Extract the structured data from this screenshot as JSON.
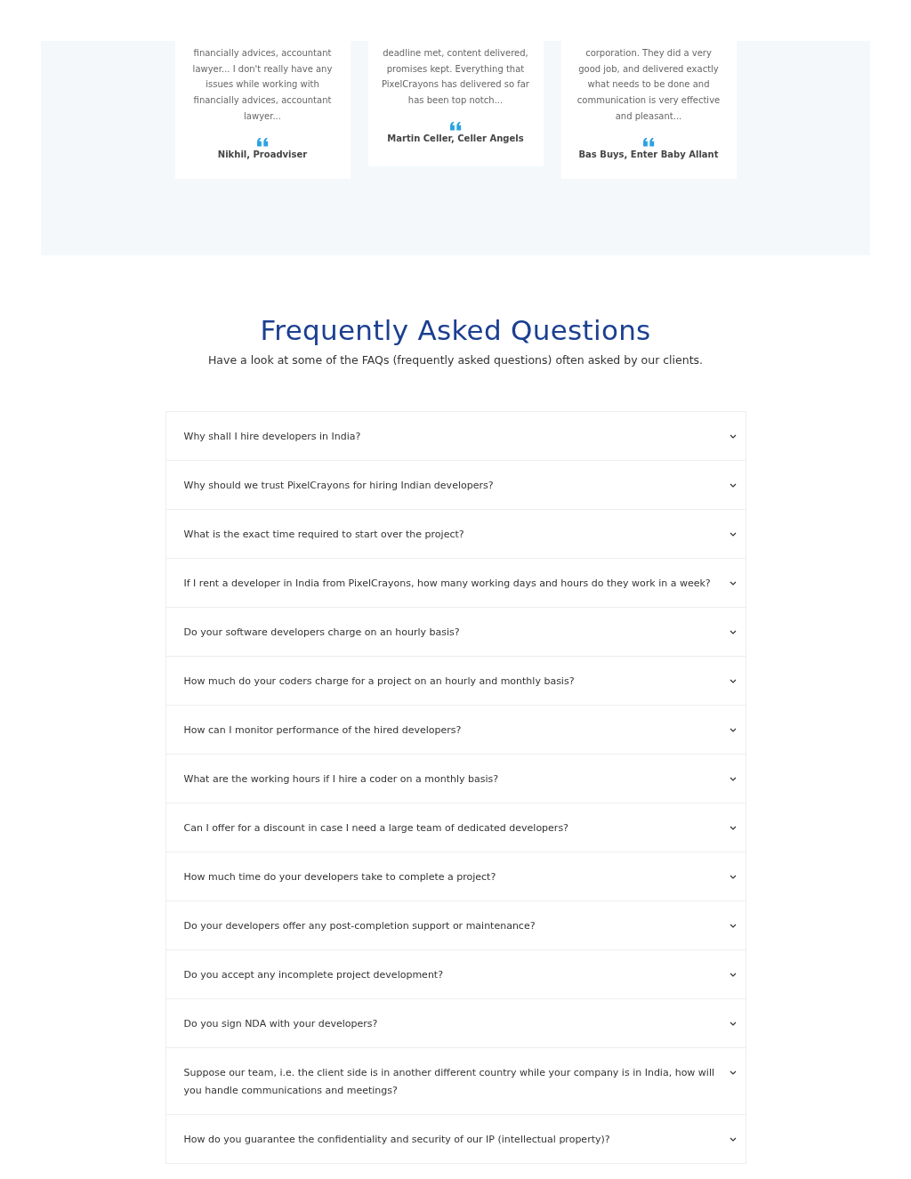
{
  "testimonials": [
    {
      "quote": "financially advices, accountant lawyer... I don't really have any issues while working with financially advices, accountant lawyer...",
      "author": "Nikhil, Proadviser"
    },
    {
      "quote": "deadline met, content delivered, promises kept. Everything that PixelCrayons has delivered so far has been top notch...",
      "author": "Martin Celler, Celler Angels"
    },
    {
      "quote": "corporation. They did a very good job, and delivered exactly what needs to be done and communication is very effective and pleasant...",
      "author": "Bas Buys, Enter Baby Allant"
    }
  ],
  "faq": {
    "title": "Frequently Asked Questions",
    "subtitle": "Have a look at some of the FAQs (frequently asked questions) often asked by our clients.",
    "items": [
      {
        "question": "Why shall I hire developers in India?",
        "expanded": false
      },
      {
        "question": "Why should we trust PixelCrayons for hiring Indian developers?",
        "expanded": false
      },
      {
        "question": "What is the exact time required to start over the project?",
        "expanded": false
      },
      {
        "question": "If I rent a developer in India from PixelCrayons, how many working days and hours do they work in a week?",
        "expanded": false
      },
      {
        "question": "Do your software developers charge on an hourly basis?",
        "expanded": false
      },
      {
        "question": "How much do your coders charge for a project on an hourly and monthly basis?",
        "expanded": false
      },
      {
        "question": "How can I monitor performance of the hired developers?",
        "expanded": false
      },
      {
        "question": "What are the working hours if I hire a coder on a monthly basis?",
        "expanded": false
      },
      {
        "question": "Can I offer for a discount in case I need a large team of dedicated developers?",
        "expanded": false
      },
      {
        "question": "How much time do your developers take to complete a project?",
        "expanded": false
      },
      {
        "question": "Do your developers offer any post-completion support or maintenance?",
        "expanded": false
      },
      {
        "question": "Do you accept any incomplete project development?",
        "expanded": false
      },
      {
        "question": "Do you sign NDA with your developers?",
        "expanded": false
      },
      {
        "question": "Suppose our team, i.e. the client side is in another different country while your company is in India, how will you handle communications and meetings?",
        "expanded": false
      },
      {
        "question": "How do you guarantee the confidentiality and security of our IP (intellectual property)?",
        "expanded": false
      }
    ]
  }
}
